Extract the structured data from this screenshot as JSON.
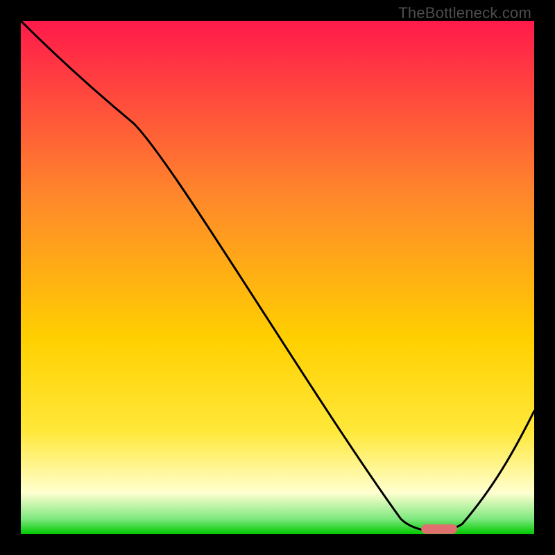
{
  "attribution": "TheBottleneck.com",
  "colors": {
    "top": "#ff1a4b",
    "mid1": "#ff8a2a",
    "mid2": "#ffd000",
    "mid3": "#ffe83a",
    "pale": "#ffffd0",
    "green1": "#7fe87f",
    "green2": "#00c800",
    "marker": "#e07070",
    "curve": "#000000",
    "frame": "#000000"
  },
  "chart_data": {
    "type": "line",
    "title": "",
    "xlabel": "",
    "ylabel": "",
    "xlim": [
      0,
      100
    ],
    "ylim": [
      0,
      100
    ],
    "categories_note": "x is parameter sweep (0 = left edge, 100 = right edge); y is bottleneck score (0 = balanced/green, 100 = worst/red)",
    "series": [
      {
        "name": "bottleneck-curve",
        "x": [
          0,
          10,
          22,
          36,
          50,
          64,
          74,
          79,
          83,
          88,
          100
        ],
        "values": [
          100,
          90,
          80,
          58,
          38,
          18,
          3,
          0,
          0,
          4,
          24
        ]
      }
    ],
    "marker": {
      "name": "optimal-range",
      "x_start": 78,
      "x_end": 85,
      "y": 1
    }
  }
}
